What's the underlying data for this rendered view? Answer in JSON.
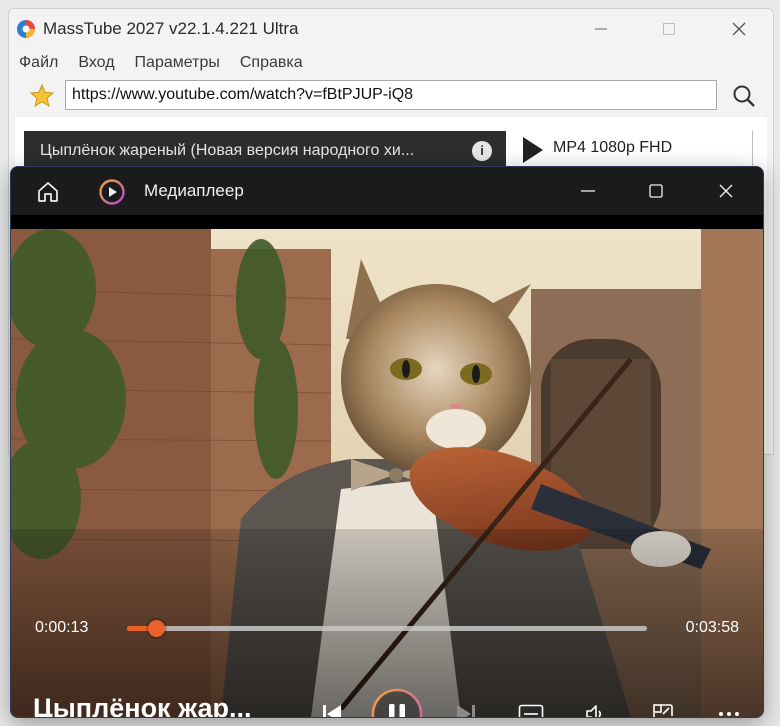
{
  "app": {
    "title": "MassTube 2027 v22.1.4.221 Ultra",
    "menu": [
      "Файл",
      "Вход",
      "Параметры",
      "Справка"
    ],
    "url": "https://www.youtube.com/watch?v=fBtPJUP-iQ8",
    "video_item": {
      "title": "Цыплёнок жареный (Новая версия народного хи...",
      "format": "MP4 1080p FHD"
    }
  },
  "player": {
    "title": "Медиаплеер",
    "now_playing": "Цыплёнок жар...",
    "time_current": "0:00:13",
    "time_total": "0:03:58",
    "progress": 0.055,
    "accent_color": "#e8622a"
  },
  "icons": {
    "app_logo": "masstube-logo-icon",
    "favorite": "star-icon",
    "search": "search-icon",
    "info": "info-icon",
    "format_play": "play-triangle-icon",
    "home": "home-icon",
    "player_logo": "media-player-logo-icon",
    "previous": "skip-previous-icon",
    "pause": "pause-icon",
    "next": "skip-next-icon",
    "subtitles": "subtitles-icon",
    "volume": "volume-icon",
    "miniplayer": "miniplayer-icon",
    "more": "more-icon"
  }
}
